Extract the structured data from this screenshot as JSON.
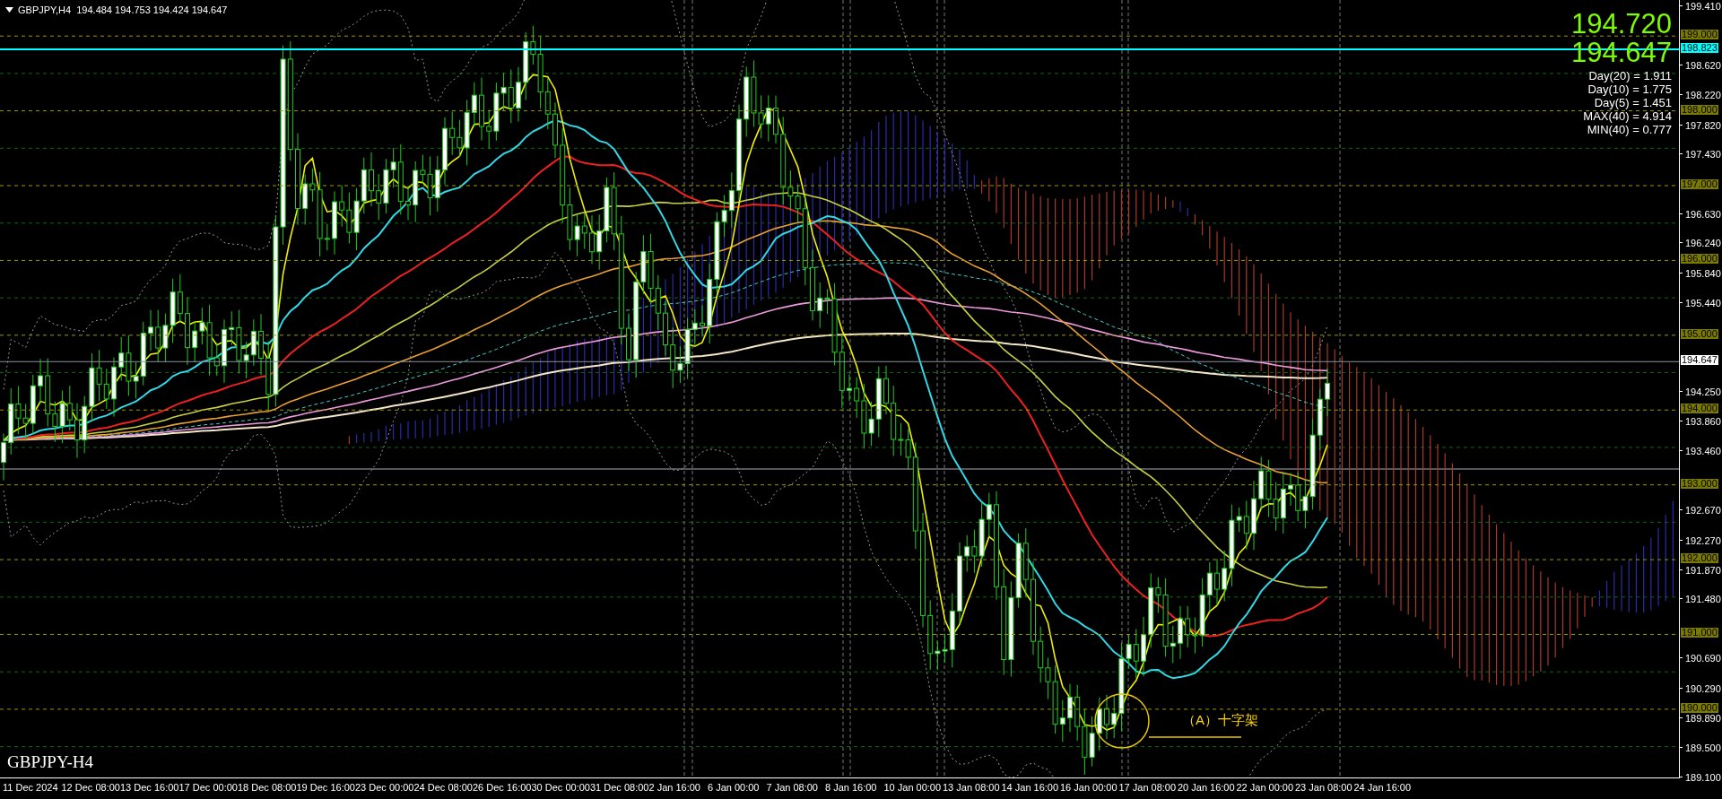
{
  "symbol_bar": {
    "title": "GBPJPY,H4  194.484 194.753 194.424 194.647"
  },
  "price_readout": {
    "ask": "194.720",
    "bid": "194.647"
  },
  "stats": [
    "Day(20) = 1.911",
    "Day(10) = 1.775",
    "Day(5) = 1.451",
    "MAX(40) = 4.914",
    "MIN(40) = 0.777"
  ],
  "price_axis": {
    "ticks": [
      "199.410",
      "198.620",
      "198.220",
      "197.820",
      "197.430",
      "196.630",
      "196.240",
      "195.840",
      "195.440",
      "194.250",
      "193.860",
      "193.460",
      "192.670",
      "192.270",
      "191.870",
      "191.480",
      "190.690",
      "190.290",
      "189.890",
      "189.500",
      "189.100"
    ],
    "levels": [
      {
        "label": "199.000",
        "kind": "level"
      },
      {
        "label": "198.823",
        "kind": "line"
      },
      {
        "label": "198.000",
        "kind": "level"
      },
      {
        "label": "197.000",
        "kind": "level"
      },
      {
        "label": "196.000",
        "kind": "level"
      },
      {
        "label": "195.000",
        "kind": "level"
      },
      {
        "label": "194.647",
        "kind": "current"
      },
      {
        "label": "194.000",
        "kind": "level"
      },
      {
        "label": "193.000",
        "kind": "level"
      },
      {
        "label": "192.000",
        "kind": "level"
      },
      {
        "label": "191.000",
        "kind": "level"
      },
      {
        "label": "190.000",
        "kind": "level"
      }
    ]
  },
  "time_axis": {
    "labels": [
      "11 Dec 2024",
      "12 Dec 08:00",
      "13 Dec 16:00",
      "17 Dec 00:00",
      "18 Dec 08:00",
      "19 Dec 16:00",
      "23 Dec 00:00",
      "24 Dec 08:00",
      "26 Dec 16:00",
      "30 Dec 00:00",
      "31 Dec 08:00",
      "2 Jan 16:00",
      "6 Jan 00:00",
      "7 Jan 08:00",
      "8 Jan 16:00",
      "10 Jan 00:00",
      "13 Jan 08:00",
      "14 Jan 16:00",
      "16 Jan 00:00",
      "17 Jan 08:00",
      "20 Jan 16:00",
      "22 Jan 00:00",
      "23 Jan 08:00",
      "24 Jan 16:00"
    ]
  },
  "annotation": {
    "text": "（A）十字架"
  },
  "chart_label": "GBPJPY-H4"
}
